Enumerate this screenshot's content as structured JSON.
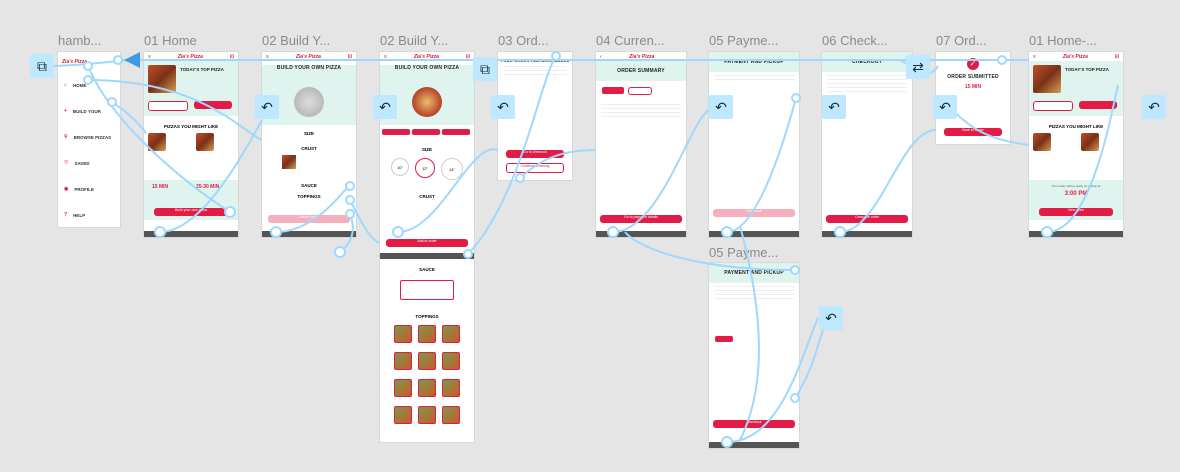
{
  "frames": [
    {
      "id": "hamburger",
      "label": "hamb..."
    },
    {
      "id": "home",
      "label": "01 Home"
    },
    {
      "id": "build1",
      "label": "02 Build Y..."
    },
    {
      "id": "build2",
      "label": "02 Build Y..."
    },
    {
      "id": "ord",
      "label": "03 Ord..."
    },
    {
      "id": "current",
      "label": "04 Curren..."
    },
    {
      "id": "payment",
      "label": "05 Payme..."
    },
    {
      "id": "checkout",
      "label": "06 Check..."
    },
    {
      "id": "order",
      "label": "07 Ord..."
    },
    {
      "id": "home2",
      "label": "01 Home-..."
    },
    {
      "id": "payment2",
      "label": "05 Payme..."
    }
  ],
  "menu": [
    "HOME",
    "BUILD YOUR",
    "BROWSE PIZZAS",
    "SAVED",
    "PROFILE",
    "HELP"
  ],
  "home": {
    "logo": "Zia's Pizza",
    "top_pizza": "TODAY'S TOP PIZZA",
    "might_like": "PIZZAS YOU MIGHT LIKE",
    "min": "15 MIN",
    "min_range": "25-30 MIN",
    "build_btn": "Build your own pizza"
  },
  "build": {
    "title": "BUILD YOUR OWN PIZZA",
    "size": "SIZE",
    "crust": "CRUST",
    "sauce": "SAUCE",
    "toppings": "TOPPINGS",
    "sizes": [
      "10\"",
      "12\"",
      "14\""
    ],
    "add_btn": "Add to order"
  },
  "ord": {
    "title": "YOUR ORDER HAS BEEN ADDED",
    "btn": "Go to checkout",
    "btn2": "Continue browsing"
  },
  "current": {
    "title": "ORDER SUMMARY",
    "btn": "Go to payment details"
  },
  "payment": {
    "title": "PAYMENT AND PICKUP",
    "btn": "Checkout"
  },
  "checkout": {
    "title": "CHECKOUT",
    "btn": "Complete order"
  },
  "order": {
    "title": "ORDER SUBMITTED",
    "min": "15 MIN",
    "btn": "Back to home"
  },
  "home2": {
    "top_pizza": "TODAY'S TOP PIZZA",
    "might_like": "PIZZAS YOU MIGHT LIKE",
    "ready": "Your order will be ready for pickup at",
    "time": "3:00 PM",
    "btn": "View order"
  },
  "icons": {
    "back": "↶",
    "device": "⧉",
    "swap": "⇄"
  }
}
